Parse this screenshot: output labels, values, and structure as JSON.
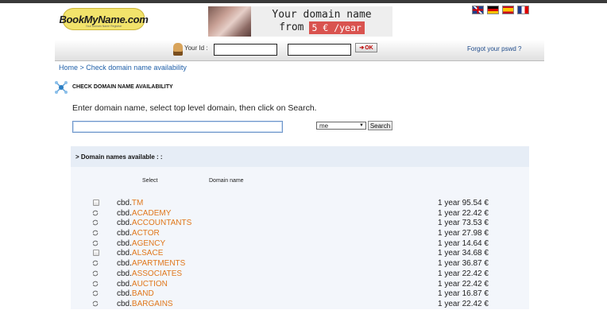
{
  "logo": {
    "text": "BookMyName.com",
    "tagline": "Your Domain Name Registrar"
  },
  "banner": {
    "line1": "Your domain name",
    "line2_prefix": "from",
    "price": "5 € /year"
  },
  "flags": [
    "uk-flag",
    "germany-flag",
    "spain-flag",
    "france-flag"
  ],
  "login": {
    "id_label": "Your Id :",
    "ok_label": "OK",
    "forgot_label": "Forgot your pswd ?"
  },
  "breadcrumb": {
    "home": "Home",
    "separator": " > ",
    "current": "Check domain name availability"
  },
  "section_title": "CHECK DOMAIN NAME AVAILABILITY",
  "instructions": "Enter domain name, select top level domain, then click on Search.",
  "search": {
    "domain_value": "",
    "tld_selected": "me",
    "button": "Search"
  },
  "results": {
    "heading": "> Domain names available : :",
    "col_select": "Select",
    "col_domain": "Domain name",
    "rows": [
      {
        "sld": "cbd.",
        "tld": "TM",
        "price": "1 year 95.54 €",
        "mark": "checkbox"
      },
      {
        "sld": "cbd.",
        "tld": "ACADEMY",
        "price": "1 year 22.42 €",
        "mark": "refresh"
      },
      {
        "sld": "cbd.",
        "tld": "ACCOUNTANTS",
        "price": "1 year 73.53 €",
        "mark": "refresh"
      },
      {
        "sld": "cbd.",
        "tld": "ACTOR",
        "price": "1 year 27.98 €",
        "mark": "refresh"
      },
      {
        "sld": "cbd.",
        "tld": "AGENCY",
        "price": "1 year 14.64 €",
        "mark": "refresh"
      },
      {
        "sld": "cbd.",
        "tld": "ALSACE",
        "price": "1 year 34.68 €",
        "mark": "checkbox"
      },
      {
        "sld": "cbd.",
        "tld": "APARTMENTS",
        "price": "1 year 36.87 €",
        "mark": "refresh"
      },
      {
        "sld": "cbd.",
        "tld": "ASSOCIATES",
        "price": "1 year 22.42 €",
        "mark": "refresh"
      },
      {
        "sld": "cbd.",
        "tld": "AUCTION",
        "price": "1 year 22.42 €",
        "mark": "refresh"
      },
      {
        "sld": "cbd.",
        "tld": "BAND",
        "price": "1 year 16.87 €",
        "mark": "refresh"
      },
      {
        "sld": "cbd.",
        "tld": "BARGAINS",
        "price": "1 year 22.42 €",
        "mark": "refresh"
      }
    ]
  }
}
